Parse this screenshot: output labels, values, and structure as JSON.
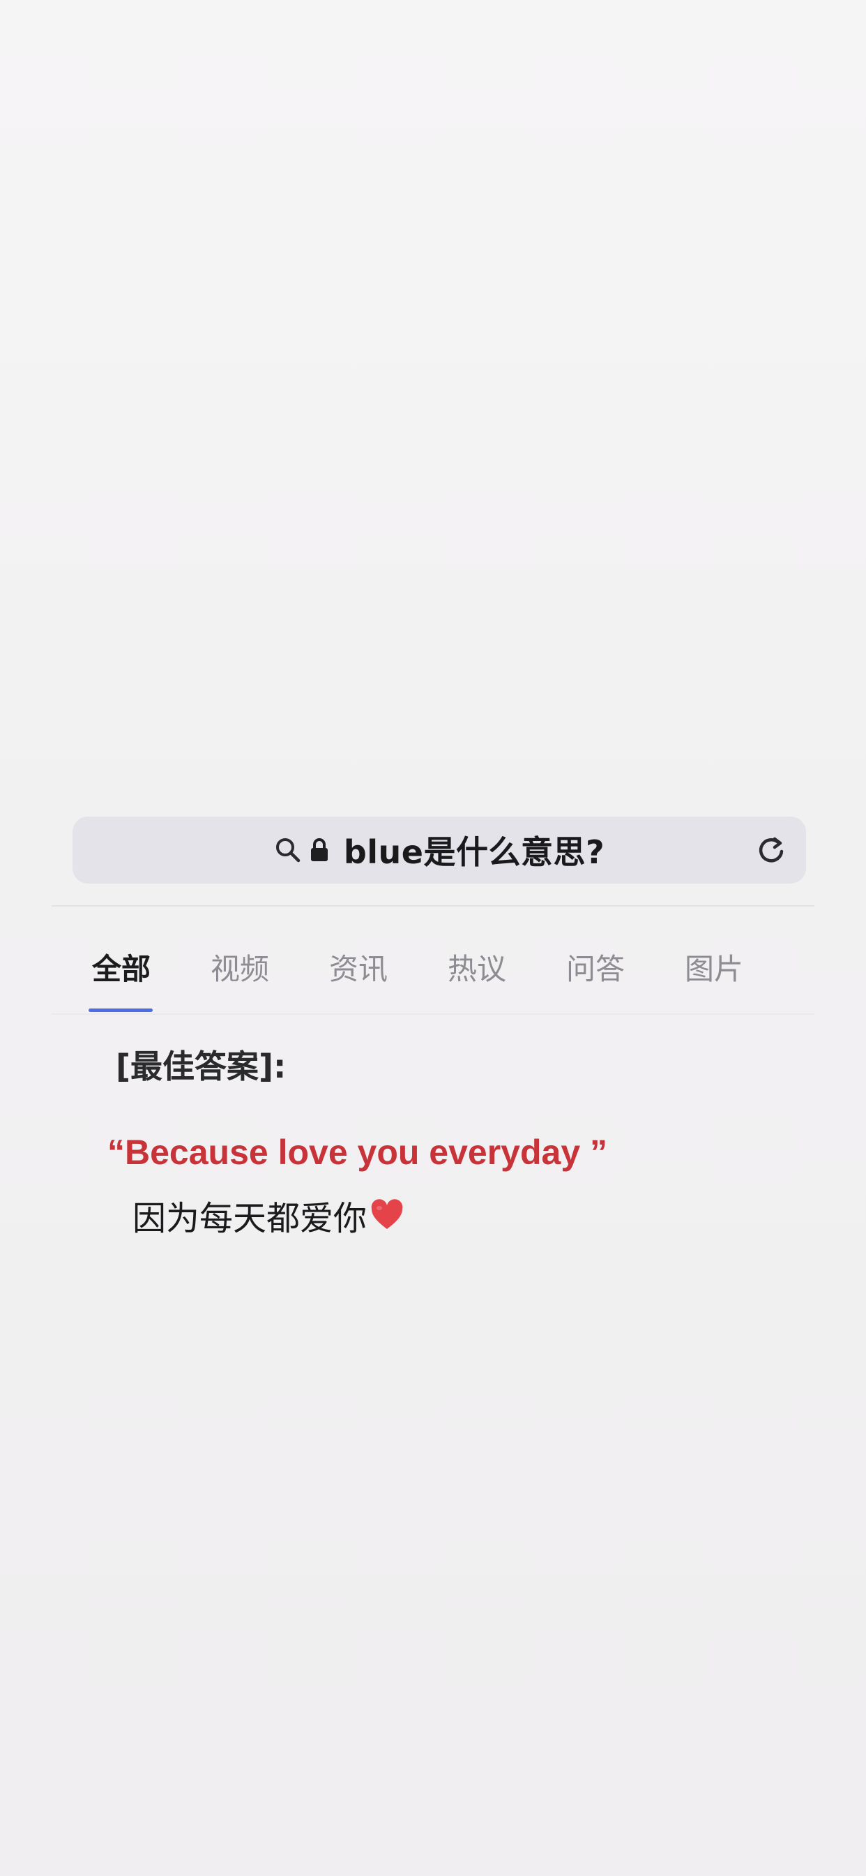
{
  "browser": {
    "url_text": "blue是什么意思?",
    "icons": {
      "search": "search-icon",
      "lock": "lock-icon",
      "reload": "reload-icon"
    }
  },
  "tabs": [
    {
      "label": "全部",
      "active": true
    },
    {
      "label": "视频",
      "active": false
    },
    {
      "label": "资讯",
      "active": false
    },
    {
      "label": "热议",
      "active": false
    },
    {
      "label": "问答",
      "active": false
    },
    {
      "label": "图片",
      "active": false
    }
  ],
  "answer": {
    "label": "[最佳答案]:",
    "english": "“Because love you everyday ”",
    "chinese": "因为每天都爱你",
    "emoji_icon": "heart-icon"
  },
  "colors": {
    "accent_underline": "#4b6ee6",
    "answer_red": "#c8333a",
    "url_bar_bg": "#e4e3e9"
  }
}
